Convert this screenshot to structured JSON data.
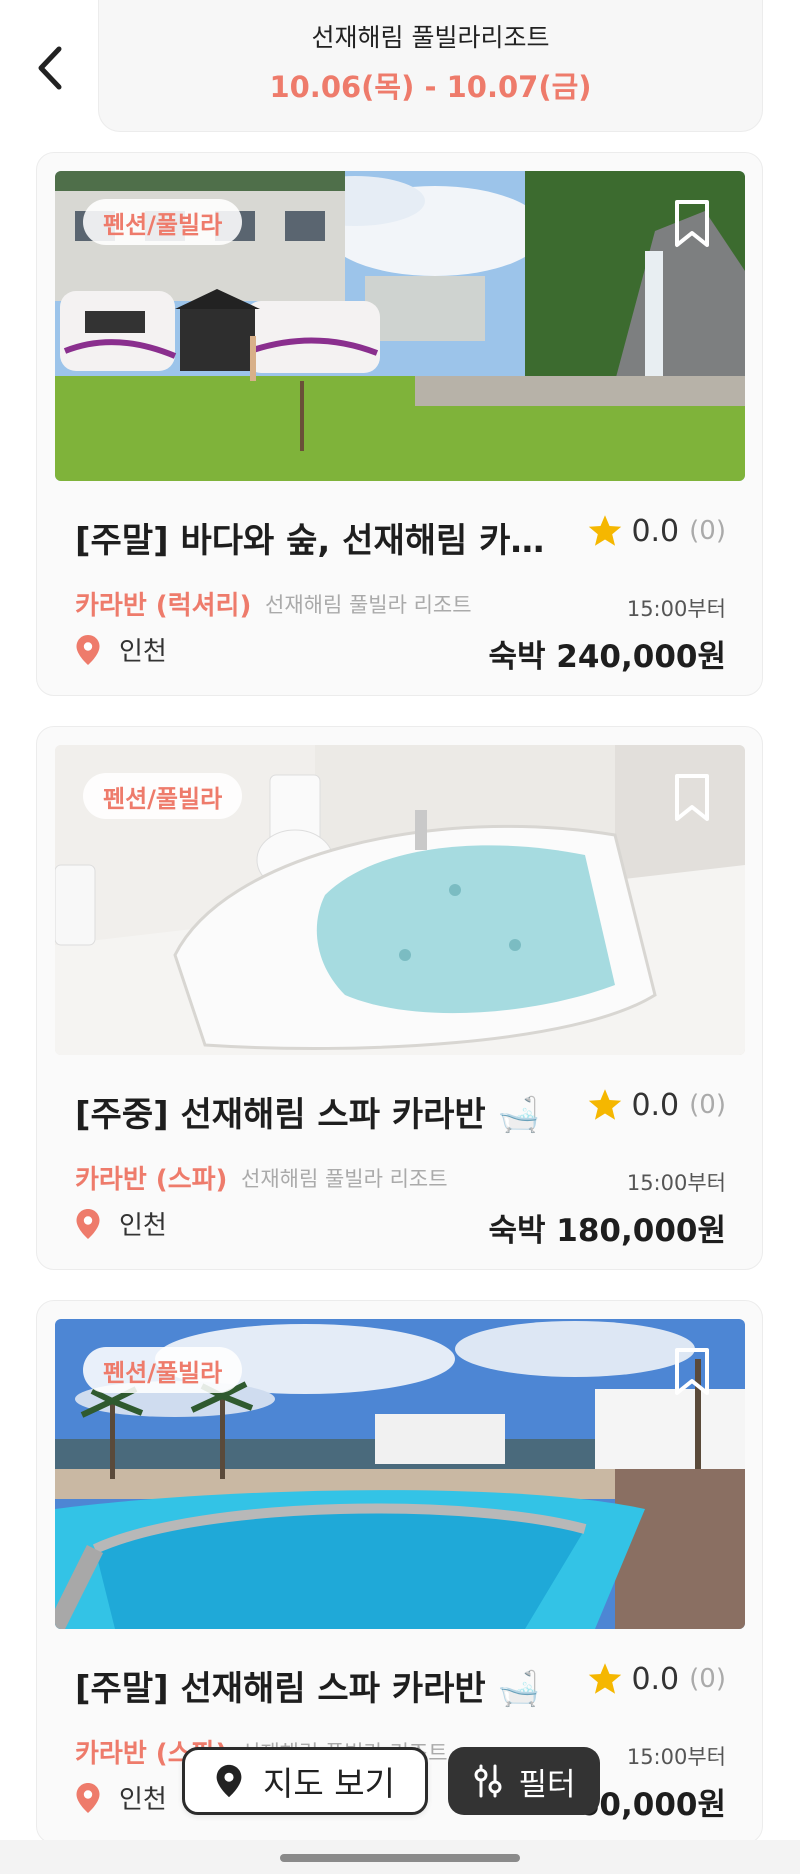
{
  "header": {
    "title": "선재해림 풀빌라리조트",
    "dates": "10.06(목) - 10.07(금)"
  },
  "listings": [
    {
      "category": "펜션/풀빌라",
      "title": "[주말] 바다와 숲, 선재해림 카라…",
      "rating": "0.0",
      "rating_count": "(0)",
      "room_type": "카라반 (럭셔리)",
      "property": "선재해림 풀빌라 리조트",
      "checkin": "15:00부터",
      "location": "인천",
      "price": "숙박 240,000원"
    },
    {
      "category": "펜션/풀빌라",
      "title": "[주중] 선재해림 스파 카라반 🛁",
      "rating": "0.0",
      "rating_count": "(0)",
      "room_type": "카라반 (스파)",
      "property": "선재해림 풀빌라 리조트",
      "checkin": "15:00부터",
      "location": "인천",
      "price": "숙박 180,000원"
    },
    {
      "category": "펜션/풀빌라",
      "title": "[주말] 선재해림 스파 카라반 🛁",
      "rating": "0.0",
      "rating_count": "(0)",
      "room_type": "카라반 (스파)",
      "property": "선재해림 풀빌라 리조트",
      "checkin": "15:00부터",
      "location": "인천",
      "price": "60,000원"
    }
  ],
  "floating": {
    "map_label": "지도 보기",
    "filter_label": "필터"
  },
  "colors": {
    "accent": "#ee7b6b",
    "star": "#f5b700",
    "dark_button": "#333333"
  },
  "icons": [
    "back-arrow-icon",
    "bookmark-icon",
    "star-icon",
    "location-pin-icon",
    "map-pin-icon",
    "filter-sliders-icon"
  ]
}
